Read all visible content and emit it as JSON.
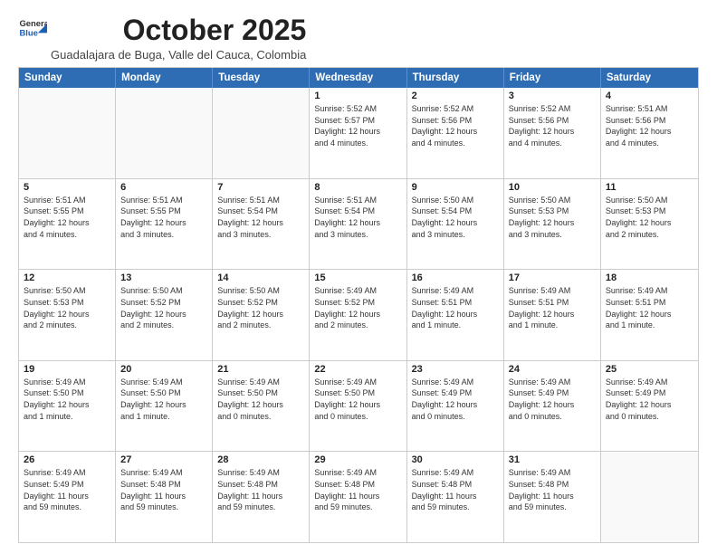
{
  "logo": {
    "line1": "General",
    "line2": "Blue"
  },
  "title": "October 2025",
  "subtitle": "Guadalajara de Buga, Valle del Cauca, Colombia",
  "weekdays": [
    "Sunday",
    "Monday",
    "Tuesday",
    "Wednesday",
    "Thursday",
    "Friday",
    "Saturday"
  ],
  "weeks": [
    [
      {
        "day": "",
        "info": ""
      },
      {
        "day": "",
        "info": ""
      },
      {
        "day": "",
        "info": ""
      },
      {
        "day": "1",
        "info": "Sunrise: 5:52 AM\nSunset: 5:57 PM\nDaylight: 12 hours\nand 4 minutes."
      },
      {
        "day": "2",
        "info": "Sunrise: 5:52 AM\nSunset: 5:56 PM\nDaylight: 12 hours\nand 4 minutes."
      },
      {
        "day": "3",
        "info": "Sunrise: 5:52 AM\nSunset: 5:56 PM\nDaylight: 12 hours\nand 4 minutes."
      },
      {
        "day": "4",
        "info": "Sunrise: 5:51 AM\nSunset: 5:56 PM\nDaylight: 12 hours\nand 4 minutes."
      }
    ],
    [
      {
        "day": "5",
        "info": "Sunrise: 5:51 AM\nSunset: 5:55 PM\nDaylight: 12 hours\nand 4 minutes."
      },
      {
        "day": "6",
        "info": "Sunrise: 5:51 AM\nSunset: 5:55 PM\nDaylight: 12 hours\nand 3 minutes."
      },
      {
        "day": "7",
        "info": "Sunrise: 5:51 AM\nSunset: 5:54 PM\nDaylight: 12 hours\nand 3 minutes."
      },
      {
        "day": "8",
        "info": "Sunrise: 5:51 AM\nSunset: 5:54 PM\nDaylight: 12 hours\nand 3 minutes."
      },
      {
        "day": "9",
        "info": "Sunrise: 5:50 AM\nSunset: 5:54 PM\nDaylight: 12 hours\nand 3 minutes."
      },
      {
        "day": "10",
        "info": "Sunrise: 5:50 AM\nSunset: 5:53 PM\nDaylight: 12 hours\nand 3 minutes."
      },
      {
        "day": "11",
        "info": "Sunrise: 5:50 AM\nSunset: 5:53 PM\nDaylight: 12 hours\nand 2 minutes."
      }
    ],
    [
      {
        "day": "12",
        "info": "Sunrise: 5:50 AM\nSunset: 5:53 PM\nDaylight: 12 hours\nand 2 minutes."
      },
      {
        "day": "13",
        "info": "Sunrise: 5:50 AM\nSunset: 5:52 PM\nDaylight: 12 hours\nand 2 minutes."
      },
      {
        "day": "14",
        "info": "Sunrise: 5:50 AM\nSunset: 5:52 PM\nDaylight: 12 hours\nand 2 minutes."
      },
      {
        "day": "15",
        "info": "Sunrise: 5:49 AM\nSunset: 5:52 PM\nDaylight: 12 hours\nand 2 minutes."
      },
      {
        "day": "16",
        "info": "Sunrise: 5:49 AM\nSunset: 5:51 PM\nDaylight: 12 hours\nand 1 minute."
      },
      {
        "day": "17",
        "info": "Sunrise: 5:49 AM\nSunset: 5:51 PM\nDaylight: 12 hours\nand 1 minute."
      },
      {
        "day": "18",
        "info": "Sunrise: 5:49 AM\nSunset: 5:51 PM\nDaylight: 12 hours\nand 1 minute."
      }
    ],
    [
      {
        "day": "19",
        "info": "Sunrise: 5:49 AM\nSunset: 5:50 PM\nDaylight: 12 hours\nand 1 minute."
      },
      {
        "day": "20",
        "info": "Sunrise: 5:49 AM\nSunset: 5:50 PM\nDaylight: 12 hours\nand 1 minute."
      },
      {
        "day": "21",
        "info": "Sunrise: 5:49 AM\nSunset: 5:50 PM\nDaylight: 12 hours\nand 0 minutes."
      },
      {
        "day": "22",
        "info": "Sunrise: 5:49 AM\nSunset: 5:50 PM\nDaylight: 12 hours\nand 0 minutes."
      },
      {
        "day": "23",
        "info": "Sunrise: 5:49 AM\nSunset: 5:49 PM\nDaylight: 12 hours\nand 0 minutes."
      },
      {
        "day": "24",
        "info": "Sunrise: 5:49 AM\nSunset: 5:49 PM\nDaylight: 12 hours\nand 0 minutes."
      },
      {
        "day": "25",
        "info": "Sunrise: 5:49 AM\nSunset: 5:49 PM\nDaylight: 12 hours\nand 0 minutes."
      }
    ],
    [
      {
        "day": "26",
        "info": "Sunrise: 5:49 AM\nSunset: 5:49 PM\nDaylight: 11 hours\nand 59 minutes."
      },
      {
        "day": "27",
        "info": "Sunrise: 5:49 AM\nSunset: 5:48 PM\nDaylight: 11 hours\nand 59 minutes."
      },
      {
        "day": "28",
        "info": "Sunrise: 5:49 AM\nSunset: 5:48 PM\nDaylight: 11 hours\nand 59 minutes."
      },
      {
        "day": "29",
        "info": "Sunrise: 5:49 AM\nSunset: 5:48 PM\nDaylight: 11 hours\nand 59 minutes."
      },
      {
        "day": "30",
        "info": "Sunrise: 5:49 AM\nSunset: 5:48 PM\nDaylight: 11 hours\nand 59 minutes."
      },
      {
        "day": "31",
        "info": "Sunrise: 5:49 AM\nSunset: 5:48 PM\nDaylight: 11 hours\nand 59 minutes."
      },
      {
        "day": "",
        "info": ""
      }
    ]
  ]
}
